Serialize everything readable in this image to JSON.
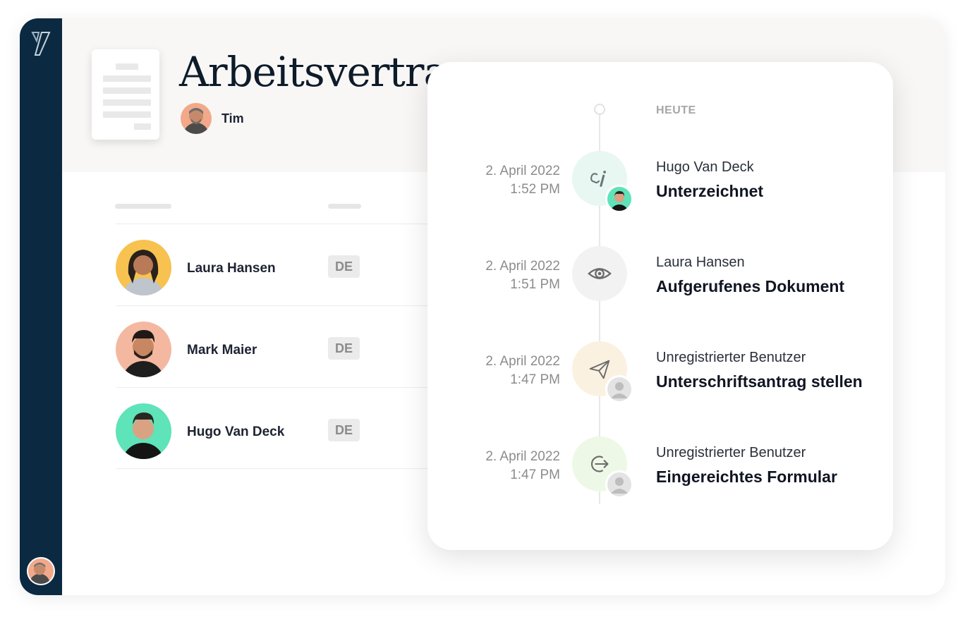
{
  "document": {
    "title": "Arbeitsvertrag",
    "owner": "Tim"
  },
  "recipients": [
    {
      "name": "Laura Hansen",
      "language": "DE",
      "avatar_color": "#f7c24f"
    },
    {
      "name": "Mark Maier",
      "language": "DE",
      "avatar_color": "#f4b8a0"
    },
    {
      "name": "Hugo Van Deck",
      "language": "DE",
      "avatar_color": "#5fe3b9"
    }
  ],
  "timeline": {
    "today_label": "HEUTE",
    "events": [
      {
        "date": "2. April 2022",
        "time": "1:52 PM",
        "actor": "Hugo Van Deck",
        "action": "Unterzeichnet",
        "icon": "signature-icon",
        "circle_color": "#e8f7f1"
      },
      {
        "date": "2. April 2022",
        "time": "1:51 PM",
        "actor": "Laura Hansen",
        "action": "Aufgerufenes Dokument",
        "icon": "eye-icon",
        "circle_color": "#f2f2f2"
      },
      {
        "date": "2. April 2022",
        "time": "1:47 PM",
        "actor": "Unregistrierter Benutzer",
        "action": "Unterschriftsantrag stellen",
        "icon": "paper-plane-icon",
        "circle_color": "#fbf1e1"
      },
      {
        "date": "2. April 2022",
        "time": "1:47 PM",
        "actor": "Unregistrierter Benutzer",
        "action": "Eingereichtes Formular",
        "icon": "submit-arrow-icon",
        "circle_color": "#eef8e6"
      }
    ]
  },
  "colors": {
    "sidebar": "#0b2a42",
    "header_bg": "#f8f7f5"
  }
}
